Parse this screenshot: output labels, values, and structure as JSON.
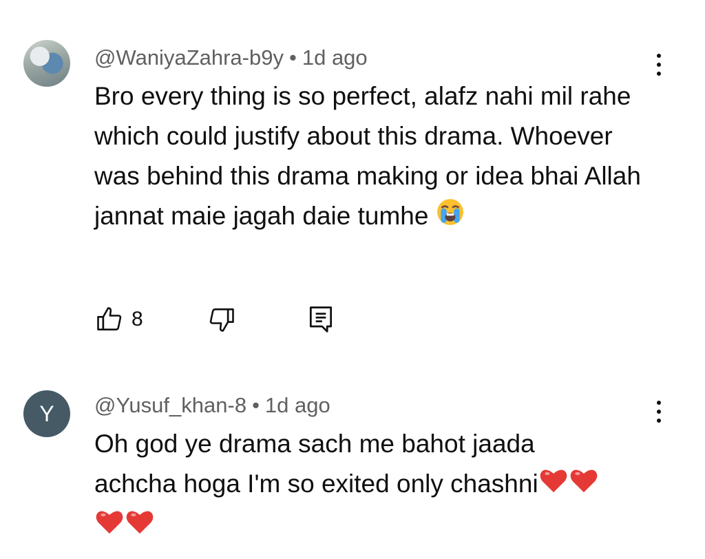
{
  "comments": [
    {
      "handle": "@WaniyaZahra-b9y",
      "separator": "•",
      "age": "1d ago",
      "text": "Bro every thing is so perfect, alafz nahi mil rahe which could justify about this drama. Whoever was behind this drama making or idea bhai Allah jannat maie jagah daie tumhe",
      "emoji": "loudly-crying-face",
      "like_count": "8",
      "avatar_type": "photo"
    },
    {
      "handle": "@Yusuf_khan-8",
      "separator": "•",
      "age": "1d ago",
      "text_line1": "Oh god ye drama sach me bahot jaada",
      "text_line2": "achcha hoga I'm so exited only chashni",
      "emoji": "red-heart",
      "avatar_letter": "Y",
      "avatar_color": "#455a64"
    }
  ],
  "icons": {
    "like": "thumbs-up-icon",
    "dislike": "thumbs-down-icon",
    "reply": "reply-icon",
    "menu": "more-vert-icon"
  }
}
